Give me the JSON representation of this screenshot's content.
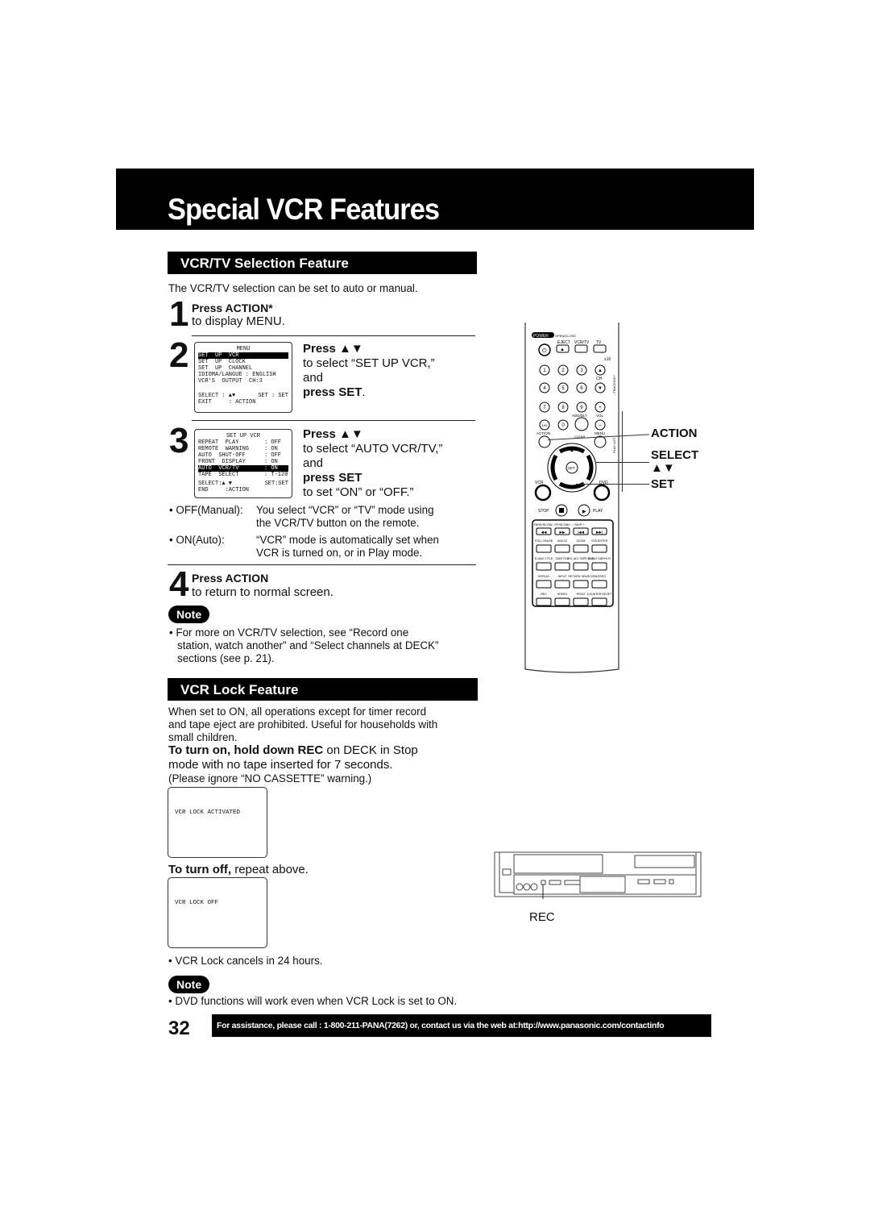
{
  "page": {
    "title": "Special VCR Features",
    "page_number": "32",
    "footer": "For assistance, please call : 1-800-211-PANA(7262) or, contact us via the web at:http://www.panasonic.com/contactinfo"
  },
  "vcrtv": {
    "heading": "VCR/TV Selection Feature",
    "intro": "The VCR/TV selection can be set to auto or manual.",
    "step1": {
      "num": "1",
      "bold": "Press ACTION*",
      "text": "to display MENU."
    },
    "step2": {
      "num": "2",
      "bold": "Press ▲▼",
      "text1": "to select “SET UP VCR,”",
      "text2": "and",
      "bold2": "press SET",
      "end": ".",
      "osd": {
        "title": "MENU",
        "items": [
          "SET  UP  VCR",
          "SET  UP  CLOCK",
          "SET  UP  CHANNEL",
          "IDIOMA/LANGUE : ENGLISH",
          "VCR'S  OUTPUT  CH:3"
        ],
        "footer_left1": "SELECT : ▲▼",
        "footer_right1": "SET : SET",
        "footer_left2": "EXIT     : ACTION"
      }
    },
    "step3": {
      "num": "3",
      "bold": "Press ▲▼",
      "text1": "to select “AUTO VCR/TV,”",
      "text2": "and",
      "bold2": "press SET",
      "text3": "to set “ON” or “OFF.”",
      "osd": {
        "title": "SET  UP  VCR",
        "rows": [
          {
            "label": "REPEAT  PLAY",
            "value": ": OFF"
          },
          {
            "label": "REMOTE  WARNING",
            "value": ": ON"
          },
          {
            "label": "AUTO  SHUT-OFF",
            "value": ": OFF"
          },
          {
            "label": "FRONT  DISPLAY",
            "value": ": ON"
          },
          {
            "label": "AUTO  VCR/TV",
            "value": ": ON"
          },
          {
            "label": "TAPE  SELECT",
            "value": ": T-120"
          }
        ],
        "footer_left1": "SELECT:▲ ▼",
        "footer_right1": "SET:SET",
        "footer_left2": "END     :ACTION"
      }
    },
    "options": [
      {
        "label": "• OFF(Manual):",
        "line1": "You select “VCR” or “TV” mode using",
        "line2": "the VCR/TV button on the remote."
      },
      {
        "label": "• ON(Auto):",
        "line1": "“VCR” mode is automatically set when",
        "line2": "VCR is turned on, or in Play mode."
      }
    ],
    "step4": {
      "num": "4",
      "bold": "Press ACTION",
      "text": "to return to normal screen."
    },
    "note_label": "Note",
    "note": [
      "• For more on VCR/TV selection, see “Record one",
      "station, watch another” and “Select channels at DECK”",
      "sections (see p. 21)."
    ]
  },
  "remote": {
    "labels": {
      "action": "ACTION",
      "select": "SELECT",
      "arrows": "▲▼",
      "set": "SET"
    },
    "buttons": {
      "power": "POWER",
      "openclose": "OPEN/CLOSE",
      "eject": "EJECT",
      "vcrtv": "VCR/TV",
      "tv": "TV",
      "ge10": "≥10",
      "ch": "CH",
      "tracking": "–TRACKING+",
      "digits": [
        "1",
        "2",
        "3",
        "4",
        "5",
        "6",
        "7",
        "8",
        "9",
        "100",
        "0"
      ],
      "adddlt": "ADD/DLT",
      "vol": "VOL",
      "action": "ACTION",
      "clear": "CLEAR",
      "menu": "MENU",
      "playlist": "PLAY LIST",
      "set": "SET",
      "vcr": "VCR",
      "dvd": "DVD",
      "stop": "STOP",
      "play": "PLAY",
      "grid_top": "REW/SLOW–  FF/SLOW+   –  SKIP  +",
      "row2": [
        "STILL PAUSE",
        "ANGLE",
        "ZOOM",
        "VSS ENTER"
      ],
      "row3": [
        "D.NAVI TITLE",
        "SUBTITLE",
        "VOL ADJ TAPE POS.",
        "AUDIO SAP/Hi-Fi"
      ],
      "row4": [
        "DISPLAY",
        "INPUT",
        "RETURN SEARCH",
        "CM/ZERO"
      ],
      "row5": [
        "REC",
        "SPEED",
        "PROG",
        "COUNTER RESET"
      ]
    }
  },
  "lock": {
    "heading": "VCR Lock Feature",
    "intro": [
      "When set to ON, all operations except for timer record",
      "and tape eject are prohibited. Useful for households with",
      "small children."
    ],
    "turn_on_bold": "To turn on, hold down REC",
    "turn_on_rest": " on DECK in Stop",
    "turn_on_line2": "mode with no tape inserted for 7 seconds.",
    "ignore": "(Please ignore “NO CASSETTE” warning.)",
    "screen1": "VCR LOCK ACTIVATED",
    "turn_off_bold": "To turn off,",
    "turn_off_rest": " repeat above.",
    "screen2": "VCR LOCK OFF",
    "rec_label": "REC",
    "cancel": "• VCR Lock cancels in 24 hours.",
    "note_label": "Note",
    "note": "• DVD functions will work even when VCR Lock is set to ON."
  }
}
